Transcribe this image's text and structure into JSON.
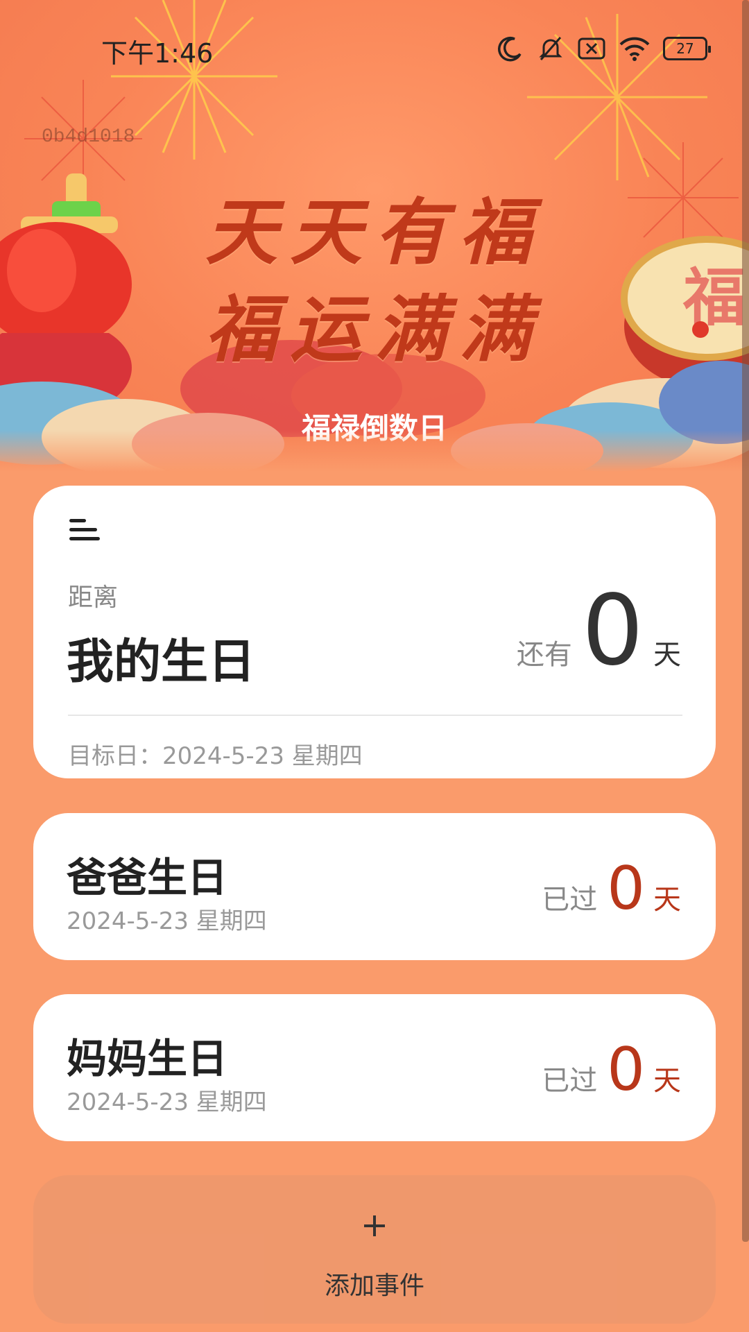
{
  "status_bar": {
    "time": "下午1:46",
    "battery": "27",
    "icons": [
      "moon-icon",
      "bell-off-icon",
      "sim-x-icon",
      "wifi-icon",
      "battery-icon"
    ]
  },
  "header": {
    "debug_id": "0b4d1018",
    "calligraphy_line1": "天天有福",
    "calligraphy_line2": "福运满满",
    "app_title": "福禄倒数日",
    "colors": {
      "bg": "#F98456",
      "calligraphy": "#C0391A"
    }
  },
  "main_card": {
    "label": "距离",
    "title": "我的生日",
    "prefix": "还有",
    "days": "0",
    "unit": "天",
    "target_date": "目标日：2024-5-23 星期四"
  },
  "events": [
    {
      "name": "爸爸生日",
      "date": "2024-5-23 星期四",
      "prefix": "已过",
      "days": "0",
      "unit": "天"
    },
    {
      "name": "妈妈生日",
      "date": "2024-5-23 星期四",
      "prefix": "已过",
      "days": "0",
      "unit": "天"
    }
  ],
  "add_button": {
    "icon": "plus-icon",
    "label": "添加事件"
  },
  "colors": {
    "page_bg": "#FA9B6B",
    "accent_red": "#B8371A"
  }
}
